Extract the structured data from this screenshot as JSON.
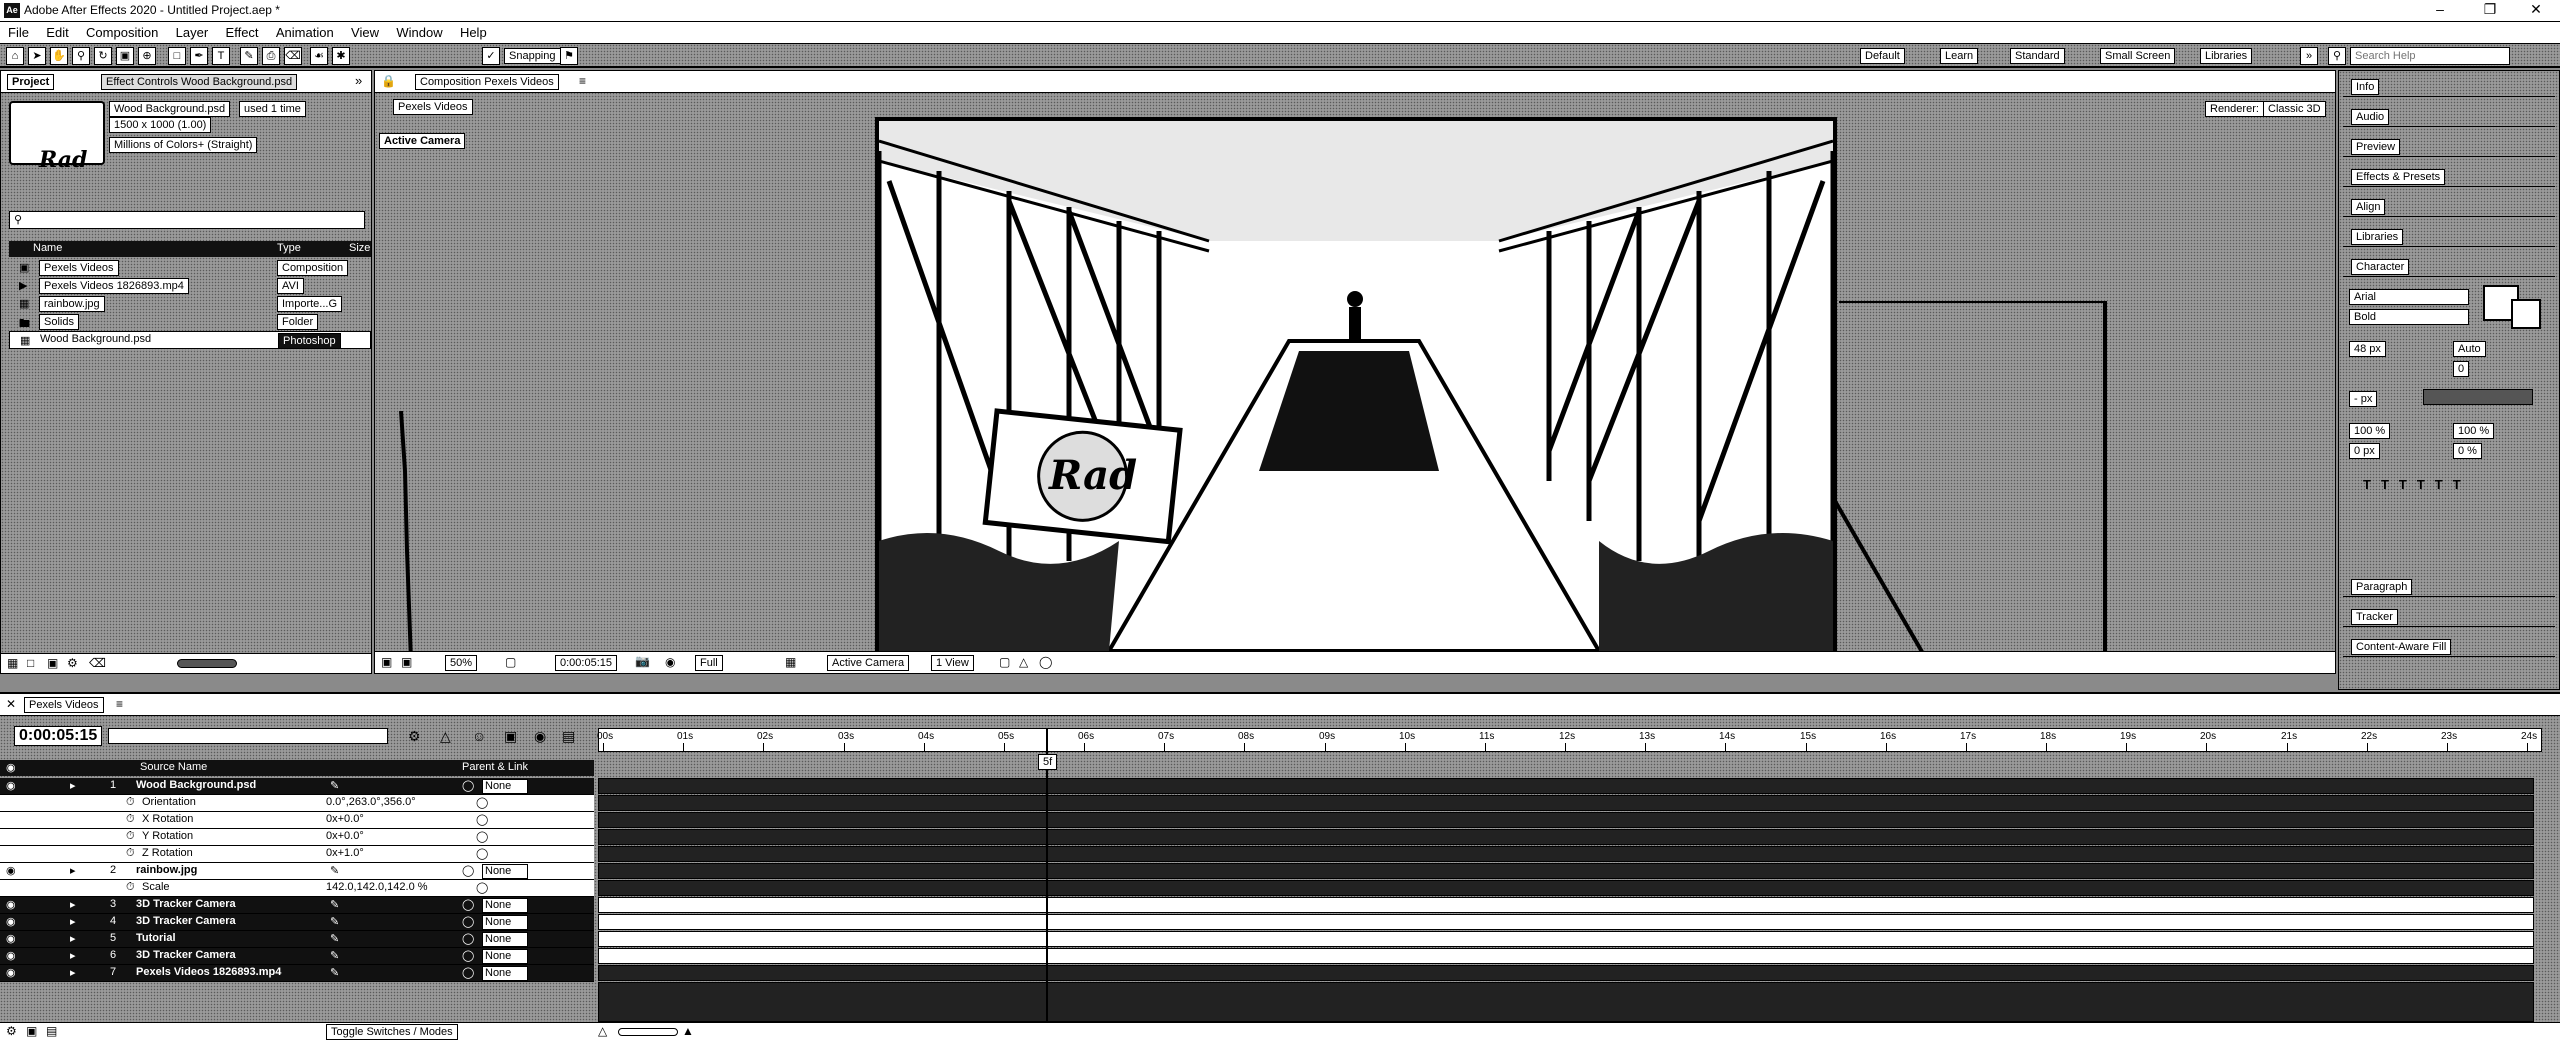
{
  "titlebar": {
    "title": "Adobe After Effects 2020 - Untitled Project.aep *",
    "logo": "Ae"
  },
  "menu": [
    "File",
    "Edit",
    "Composition",
    "Layer",
    "Effect",
    "Animation",
    "View",
    "Window",
    "Help"
  ],
  "toolbar": {
    "snapping": "Snapping",
    "workspaces": [
      "Default",
      "Learn",
      "Standard",
      "Small Screen",
      "Libraries"
    ],
    "search_placeholder": "Search Help"
  },
  "project": {
    "tab": "Project",
    "effect_controls_tab": "Effect Controls Wood Background.psd",
    "thumb_text": "Rad",
    "item_name": "Wood Background.psd",
    "used": "used 1 time",
    "dims": "1500 x 1000 (1.00)",
    "colors": "Millions of Colors+ (Straight)",
    "columns": {
      "name": "Name",
      "type": "Type",
      "size": "Size"
    },
    "items": [
      {
        "name": "Pexels Videos",
        "type": "Composition"
      },
      {
        "name": "Pexels Videos 1826893.mp4",
        "type": "AVI"
      },
      {
        "name": "rainbow.jpg",
        "type": "Importe...G"
      },
      {
        "name": "Solids",
        "type": "Folder"
      },
      {
        "name": "Wood Background.psd",
        "type": "Photoshop"
      }
    ]
  },
  "comp": {
    "tab": "Composition Pexels Videos",
    "subtab": "Pexels Videos",
    "active_camera": "Active Camera",
    "renderer_label": "Renderer:",
    "renderer": "Classic 3D",
    "logo_text": "Rad",
    "footer": {
      "zoom": "50%",
      "time": "0:00:05:15",
      "res": "Full",
      "camera": "Active Camera",
      "view": "1 View"
    }
  },
  "right_panel": {
    "items": [
      "Info",
      "Audio",
      "Preview",
      "Effects & Presets",
      "Align",
      "Libraries",
      "Character"
    ],
    "character": {
      "font": "Arial",
      "style": "Bold",
      "size": "48 px",
      "leading": "Auto",
      "tracking": "0",
      "stroke": "- px",
      "vscale": "100 %",
      "hscale": "100 %",
      "baseline": "0 px",
      "tsume": "0 %"
    },
    "bottom_items": [
      "Paragraph",
      "Tracker",
      "Content-Aware Fill"
    ]
  },
  "timeline": {
    "tab": "Pexels Videos",
    "timecode": "0:00:05:15",
    "col_source": "Source Name",
    "col_parent": "Parent & Link",
    "ticks": [
      "00s",
      "01s",
      "02s",
      "03s",
      "04s",
      "05s",
      "06s",
      "07s",
      "08s",
      "09s",
      "10s",
      "11s",
      "12s",
      "13s",
      "14s",
      "15s",
      "16s",
      "17s",
      "18s",
      "19s",
      "20s",
      "21s",
      "22s",
      "23s",
      "24s"
    ],
    "current_frame": "5f",
    "layers": [
      {
        "kind": "layer",
        "idx": "1",
        "name": "Wood Background.psd",
        "parent": "None"
      },
      {
        "kind": "prop",
        "name": "Orientation",
        "value": "0.0°,263.0°,356.0°"
      },
      {
        "kind": "prop",
        "name": "X Rotation",
        "value": "0x+0.0°"
      },
      {
        "kind": "prop",
        "name": "Y Rotation",
        "value": "0x+0.0°"
      },
      {
        "kind": "prop",
        "name": "Z Rotation",
        "value": "0x+1.0°"
      },
      {
        "kind": "layer",
        "idx": "2",
        "name": "rainbow.jpg",
        "parent": "None"
      },
      {
        "kind": "prop",
        "name": "Scale",
        "value": "142.0,142.0,142.0 %"
      },
      {
        "kind": "layer",
        "idx": "3",
        "name": "3D Tracker Camera",
        "parent": "None"
      },
      {
        "kind": "layer",
        "idx": "4",
        "name": "3D Tracker Camera",
        "parent": "None"
      },
      {
        "kind": "layer",
        "idx": "5",
        "name": "Tutorial",
        "parent": "None"
      },
      {
        "kind": "layer",
        "idx": "6",
        "name": "3D Tracker Camera",
        "parent": "None"
      },
      {
        "kind": "layer",
        "idx": "7",
        "name": "Pexels Videos 1826893.mp4",
        "parent": "None"
      }
    ],
    "footer": "Toggle Switches / Modes"
  }
}
